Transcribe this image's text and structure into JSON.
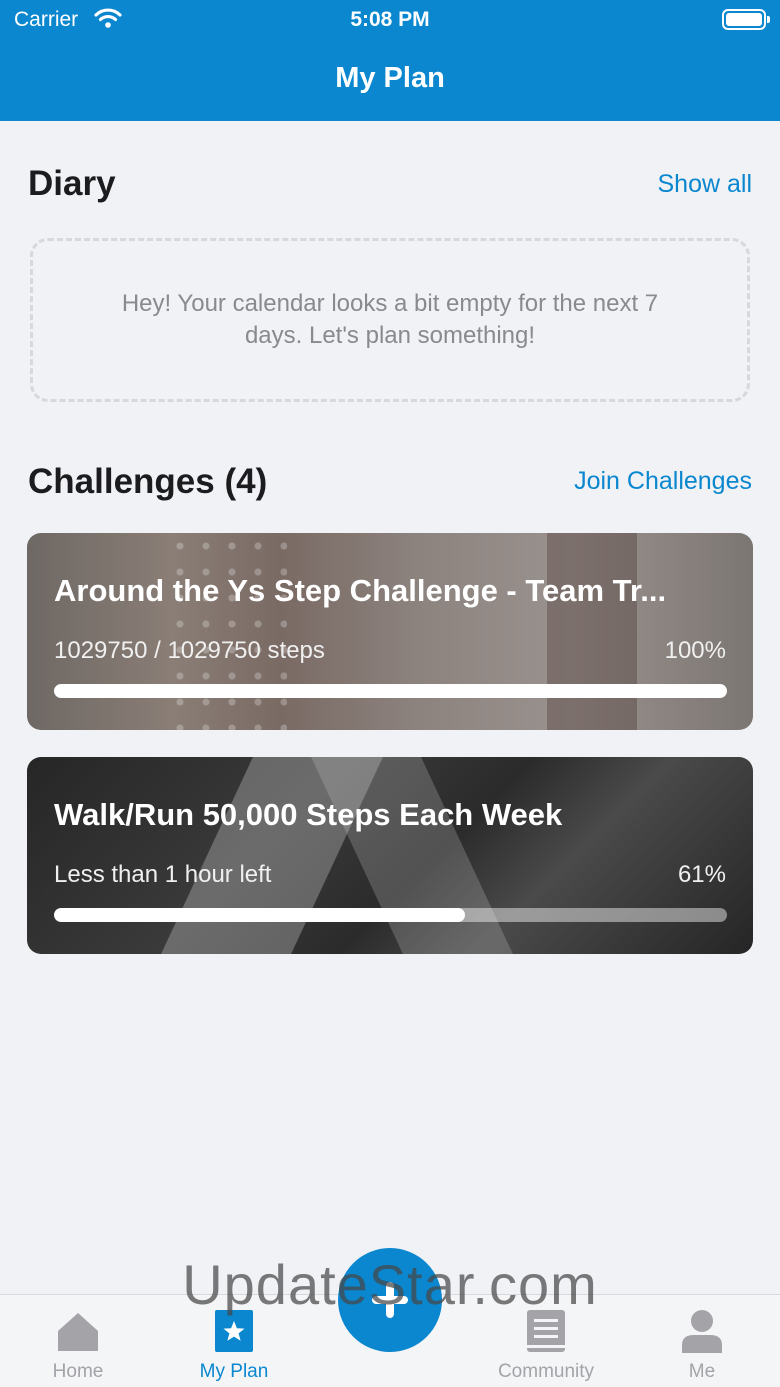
{
  "status_bar": {
    "carrier": "Carrier",
    "time": "5:08 PM"
  },
  "nav": {
    "title": "My Plan"
  },
  "diary": {
    "title": "Diary",
    "show_all": "Show all",
    "empty_message": "Hey! Your calendar looks a bit empty for the next 7 days. Let's plan something!"
  },
  "challenges": {
    "title": "Challenges (4)",
    "join": "Join Challenges",
    "items": [
      {
        "title": "Around the Ys Step Challenge - Team Tr...",
        "subtitle": "1029750 / 1029750 steps",
        "percent_label": "100%",
        "progress": 1.0
      },
      {
        "title": "Walk/Run 50,000 Steps Each Week",
        "subtitle": "Less than 1 hour left",
        "percent_label": "61%",
        "progress": 0.61
      }
    ]
  },
  "tabbar": {
    "items": [
      {
        "label": "Home",
        "icon": "home-icon",
        "active": false
      },
      {
        "label": "My Plan",
        "icon": "star-calendar-icon",
        "active": true
      },
      {
        "label": "",
        "icon": "plus-icon",
        "active": false
      },
      {
        "label": "Community",
        "icon": "book-icon",
        "active": false
      },
      {
        "label": "Me",
        "icon": "person-icon",
        "active": false
      }
    ]
  },
  "watermark": "UpdateStar.com",
  "colors": {
    "accent": "#0a87cf",
    "background": "#f0f2f6",
    "inactive": "#a3a3a8"
  }
}
